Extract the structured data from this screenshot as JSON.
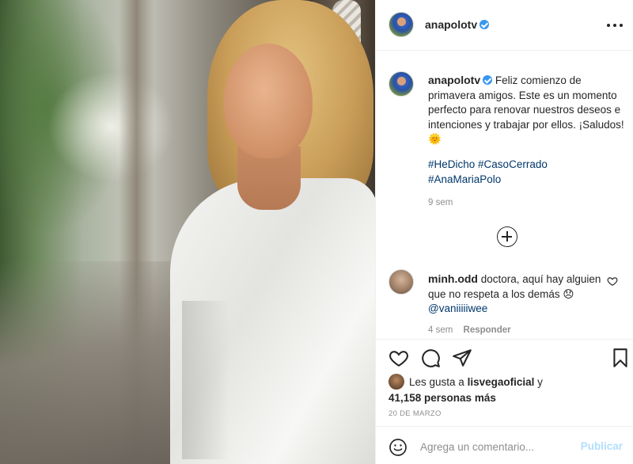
{
  "post": {
    "author": "anapolotv",
    "caption": "Feliz comienzo de primavera amigos. Este es un momento perfecto para renovar nuestros deseos e intenciones y trabajar por ellos. ¡Saludos! 🌞",
    "hashtags": [
      "#HeDicho",
      "#CasoCerrado",
      "#AnaMariaPolo"
    ],
    "time_ago": "9 sem",
    "date": "20 DE MARZO"
  },
  "comment": {
    "author": "minh.odd",
    "text": "doctora, aquí hay alguien que no respeta a los demás 😞",
    "mention": "@vaniiiiiwee",
    "time_ago": "4 sem",
    "reply_label": "Responder"
  },
  "likes": {
    "prefix": "Les gusta a",
    "user": "lisvegaoficial",
    "joiner": "y",
    "others": "41,158 personas más"
  },
  "comment_box": {
    "placeholder": "Agrega un comentario...",
    "publish_label": "Publicar"
  },
  "icons": {
    "like": "heart-icon",
    "comment": "comment-icon",
    "share": "share-icon",
    "save": "bookmark-icon",
    "more": "more-icon",
    "load_more": "plus-circle-icon",
    "emoji": "emoji-icon",
    "verified": "verified-badge-icon"
  },
  "colors": {
    "link": "#00376b",
    "verified": "#3897f0",
    "muted": "#8e8e8e",
    "publish_disabled": "#b2dffc"
  }
}
